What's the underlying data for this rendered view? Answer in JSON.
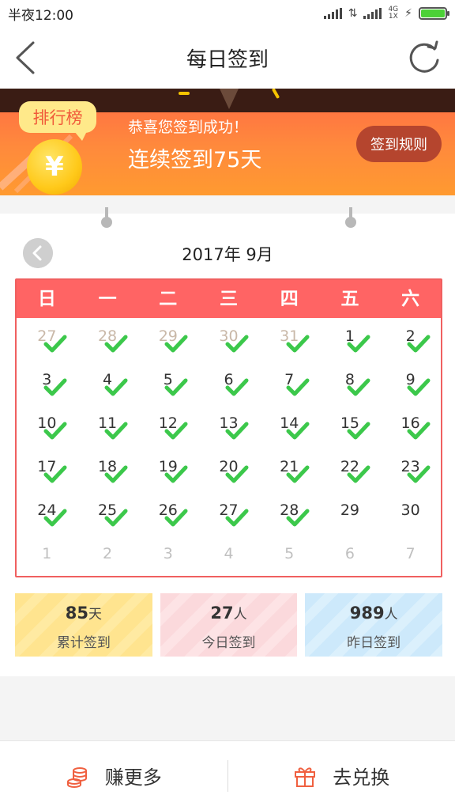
{
  "status_bar": {
    "time": "半夜12:00",
    "net_label_top": "4G",
    "net_label_bottom": "1X"
  },
  "nav": {
    "title": "每日签到",
    "back_icon": "chevron-left-icon",
    "refresh_icon": "refresh-icon"
  },
  "banner": {
    "rank_label": "排行榜",
    "congrats": "恭喜您签到成功！",
    "streak": "连续签到75天",
    "rules_button": "签到规则",
    "coin_symbol": "¥"
  },
  "calendar": {
    "month_title": "2017年 9月",
    "weekdays": [
      "日",
      "一",
      "二",
      "三",
      "四",
      "五",
      "六"
    ],
    "days": [
      {
        "label": "27",
        "checked": true,
        "kind": "prev"
      },
      {
        "label": "28",
        "checked": true,
        "kind": "prev"
      },
      {
        "label": "29",
        "checked": true,
        "kind": "prev"
      },
      {
        "label": "30",
        "checked": true,
        "kind": "prev"
      },
      {
        "label": "31",
        "checked": true,
        "kind": "prev"
      },
      {
        "label": "1",
        "checked": true,
        "kind": "cur"
      },
      {
        "label": "2",
        "checked": true,
        "kind": "cur"
      },
      {
        "label": "3",
        "checked": true,
        "kind": "cur"
      },
      {
        "label": "4",
        "checked": true,
        "kind": "cur"
      },
      {
        "label": "5",
        "checked": true,
        "kind": "cur"
      },
      {
        "label": "6",
        "checked": true,
        "kind": "cur"
      },
      {
        "label": "7",
        "checked": true,
        "kind": "cur"
      },
      {
        "label": "8",
        "checked": true,
        "kind": "cur"
      },
      {
        "label": "9",
        "checked": true,
        "kind": "cur"
      },
      {
        "label": "10",
        "checked": true,
        "kind": "cur"
      },
      {
        "label": "11",
        "checked": true,
        "kind": "cur"
      },
      {
        "label": "12",
        "checked": true,
        "kind": "cur"
      },
      {
        "label": "13",
        "checked": true,
        "kind": "cur"
      },
      {
        "label": "14",
        "checked": true,
        "kind": "cur"
      },
      {
        "label": "15",
        "checked": true,
        "kind": "cur"
      },
      {
        "label": "16",
        "checked": true,
        "kind": "cur"
      },
      {
        "label": "17",
        "checked": true,
        "kind": "cur"
      },
      {
        "label": "18",
        "checked": true,
        "kind": "cur"
      },
      {
        "label": "19",
        "checked": true,
        "kind": "cur"
      },
      {
        "label": "20",
        "checked": true,
        "kind": "cur"
      },
      {
        "label": "21",
        "checked": true,
        "kind": "cur"
      },
      {
        "label": "22",
        "checked": true,
        "kind": "cur"
      },
      {
        "label": "23",
        "checked": true,
        "kind": "cur"
      },
      {
        "label": "24",
        "checked": true,
        "kind": "cur"
      },
      {
        "label": "25",
        "checked": true,
        "kind": "cur"
      },
      {
        "label": "26",
        "checked": true,
        "kind": "cur"
      },
      {
        "label": "27",
        "checked": true,
        "kind": "cur"
      },
      {
        "label": "28",
        "checked": true,
        "kind": "cur"
      },
      {
        "label": "29",
        "checked": false,
        "kind": "cur"
      },
      {
        "label": "30",
        "checked": false,
        "kind": "cur"
      },
      {
        "label": "1",
        "checked": false,
        "kind": "next"
      },
      {
        "label": "2",
        "checked": false,
        "kind": "next"
      },
      {
        "label": "3",
        "checked": false,
        "kind": "next"
      },
      {
        "label": "4",
        "checked": false,
        "kind": "next"
      },
      {
        "label": "5",
        "checked": false,
        "kind": "next"
      },
      {
        "label": "6",
        "checked": false,
        "kind": "next"
      },
      {
        "label": "7",
        "checked": false,
        "kind": "next"
      }
    ]
  },
  "stats": {
    "total": {
      "value": "85",
      "unit": "天",
      "label": "累计签到"
    },
    "today": {
      "value": "27",
      "unit": "人",
      "label": "今日签到"
    },
    "yesterday": {
      "value": "989",
      "unit": "人",
      "label": "昨日签到"
    }
  },
  "bottom": {
    "earn_label": "赚更多",
    "earn_icon": "coins-icon",
    "exchange_label": "去兑换",
    "exchange_icon": "gift-icon"
  },
  "colors": {
    "accent": "#ff6464",
    "check": "#3cc84b",
    "banner_orange": "#ff8a3c",
    "bottom_icon": "#f06040"
  }
}
